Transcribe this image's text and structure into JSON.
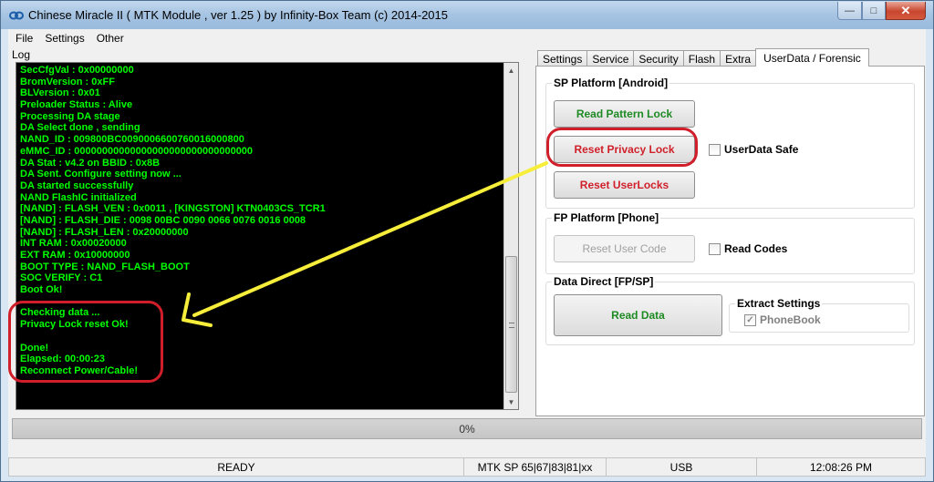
{
  "window": {
    "title": "Chinese Miracle II ( MTK Module , ver 1.25 ) by Infinity-Box Team (c) 2014-2015",
    "icon": "infinity-icon"
  },
  "menu": [
    "File",
    "Settings",
    "Other"
  ],
  "log": {
    "label": "Log",
    "lines": [
      "SecCfgVal : 0x00000000",
      "BromVersion : 0xFF",
      "BLVersion : 0x01",
      "Preloader Status : Alive",
      "Processing DA stage",
      "DA Select done , sending",
      "NAND_ID : 009800BC0090006600760016000800",
      "eMMC_ID : 00000000000000000000000000000000",
      "DA Stat : v4.2 on BBID : 0x8B",
      "DA Sent. Configure setting now ...",
      "DA started successfully",
      "NAND FlashIC initialized",
      "[NAND] : FLASH_VEN : 0x0011 , [KINGSTON] KTN0403CS_TCR1",
      "[NAND] : FLASH_DIE : 0098 00BC 0090 0066 0076 0016 0008",
      "[NAND] : FLASH_LEN : 0x20000000",
      "INT RAM    : 0x00020000",
      "EXT RAM    : 0x10000000",
      "BOOT TYPE  : NAND_FLASH_BOOT",
      "SOC VERIFY : C1",
      "Boot Ok!",
      "",
      "Checking data ...",
      "Privacy Lock reset Ok!",
      "",
      "Done!",
      "Elapsed: 00:00:23",
      "Reconnect Power/Cable!"
    ]
  },
  "tabs": [
    {
      "label": "Settings",
      "active": false
    },
    {
      "label": "Service",
      "active": false
    },
    {
      "label": "Security",
      "active": false
    },
    {
      "label": "Flash",
      "active": false
    },
    {
      "label": "Extra",
      "active": false
    },
    {
      "label": "UserData / Forensic",
      "active": true
    }
  ],
  "sp_platform": {
    "title": "SP Platform [Android]",
    "read_pattern_lock": "Read Pattern Lock",
    "reset_privacy_lock": "Reset Privacy Lock",
    "reset_userlocks": "Reset UserLocks",
    "userdata_safe": "UserData Safe"
  },
  "fp_platform": {
    "title": "FP Platform [Phone]",
    "reset_user_code": "Reset User Code",
    "read_codes": "Read Codes"
  },
  "data_direct": {
    "title": "Data Direct  [FP/SP]",
    "read_data": "Read Data",
    "extract_title": "Extract Settings",
    "phonebook": "PhoneBook",
    "phonebook_checked": true
  },
  "progress": {
    "text": "0%",
    "value": 0
  },
  "status": {
    "state": "READY",
    "chip": "MTK SP 65|67|83|81|xx",
    "port": "USB",
    "time": "12:08:26 PM"
  },
  "colors": {
    "log_text": "#00ff00",
    "accent_red": "#d01e2a",
    "button_green": "#1e8a23",
    "arrow_yellow": "#f6ee3a"
  }
}
